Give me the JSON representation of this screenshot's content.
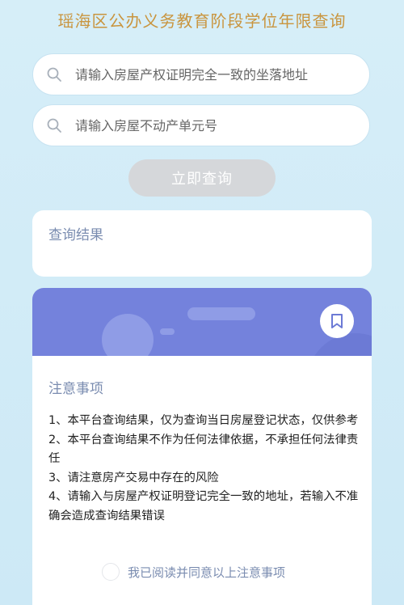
{
  "page": {
    "title": "瑶海区公办义务教育阶段学位年限查询"
  },
  "search": {
    "address_placeholder": "请输入房屋产权证明完全一致的坐落地址",
    "unit_placeholder": "请输入房屋不动产单元号",
    "submit_label": "立即查询"
  },
  "result": {
    "label": "查询结果"
  },
  "notice": {
    "title": "注意事项",
    "items": [
      "1、本平台查询结果，仅为查询当日房屋登记状态，仅供参考",
      "2、本平台查询结果不作为任何法律依据，不承担任何法律责任",
      "3、请注意房产交易中存在的风险",
      "4、请输入与房屋产权证明登记完全一致的地址，若输入不准确会造成查询结果错误"
    ],
    "agree_label": "我已阅读并同意以上注意事项",
    "agree_checked": false
  },
  "icons": {
    "search": "search-icon",
    "bookmark": "bookmark-icon"
  },
  "colors": {
    "title": "#c9953f",
    "banner": "#7482dc",
    "accent_text": "#7a8cb0",
    "button_disabled": "#d5d7da",
    "background": "#d6eef8"
  }
}
